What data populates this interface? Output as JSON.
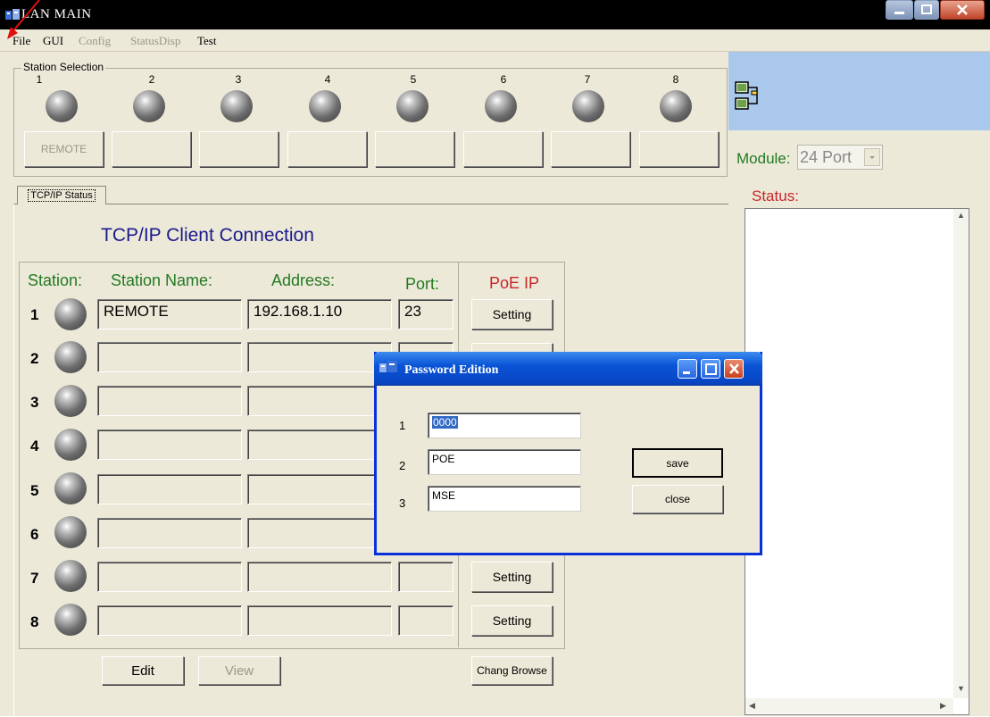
{
  "window": {
    "title": "LAN MAIN"
  },
  "menu": {
    "items": [
      "File",
      "GUI",
      "Config",
      "StatusDisp",
      "Test"
    ]
  },
  "station_selection": {
    "label": "Station Selection",
    "numbers": [
      "1",
      "2",
      "3",
      "4",
      "5",
      "6",
      "7",
      "8"
    ],
    "buttons": [
      "REMOTE",
      "",
      "",
      "",
      "",
      "",
      "",
      ""
    ]
  },
  "tab": {
    "label": "TCP/IP Status"
  },
  "tcpip": {
    "title": "TCP/IP Client Connection",
    "headers": {
      "station": "Station:",
      "name": "Station Name:",
      "address": "Address:",
      "port": "Port:",
      "poe": "PoE IP"
    },
    "rows": [
      {
        "num": "1",
        "name": "REMOTE",
        "address": "192.168.1.10",
        "port": "23",
        "setting": "Setting"
      },
      {
        "num": "2",
        "name": "",
        "address": "",
        "port": "",
        "setting": "Setting"
      },
      {
        "num": "3",
        "name": "",
        "address": "",
        "port": "",
        "setting": ""
      },
      {
        "num": "4",
        "name": "",
        "address": "",
        "port": "",
        "setting": ""
      },
      {
        "num": "5",
        "name": "",
        "address": "",
        "port": "",
        "setting": ""
      },
      {
        "num": "6",
        "name": "",
        "address": "",
        "port": "",
        "setting": ""
      },
      {
        "num": "7",
        "name": "",
        "address": "",
        "port": "",
        "setting": "Setting"
      },
      {
        "num": "8",
        "name": "",
        "address": "",
        "port": "",
        "setting": "Setting"
      }
    ],
    "edit_button": "Edit",
    "view_button": "View",
    "browse_button": "Chang Browse"
  },
  "module": {
    "label": "Module:",
    "value": "24 Port"
  },
  "status": {
    "label": "Status:"
  },
  "dialog": {
    "title": "Password Edition",
    "fields": [
      {
        "num": "1",
        "value": "0000"
      },
      {
        "num": "2",
        "value": "POE"
      },
      {
        "num": "3",
        "value": "MSE"
      }
    ],
    "save_button": "save",
    "close_button": "close"
  },
  "colors": {
    "accent_green": "#237a23",
    "accent_red": "#c8262b",
    "title_blue": "#1a1a8c",
    "dialog_blue": "#0a54d6"
  }
}
